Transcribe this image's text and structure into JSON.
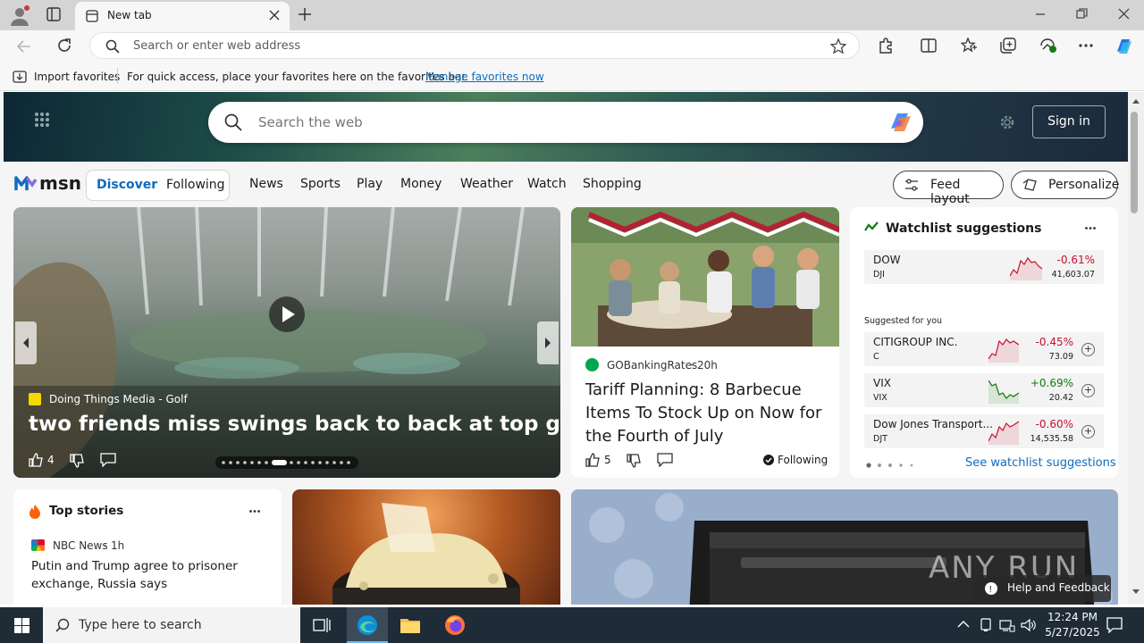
{
  "browser": {
    "tab_title": "New tab",
    "address_placeholder": "Search or enter web address",
    "favorites_bar": {
      "import_label": "Import favorites",
      "message": "For quick access, place your favorites here on the favorites bar.",
      "manage_link": "Manage favorites now"
    }
  },
  "msn": {
    "search_placeholder": "Search the web",
    "sign_in": "Sign in",
    "logo_text": "msn",
    "toggle": {
      "discover": "Discover",
      "following": "Following"
    },
    "nav": [
      "News",
      "Sports",
      "Play",
      "Money",
      "Weather",
      "Watch",
      "Shopping"
    ],
    "feed_layout": "Feed layout",
    "personalize": "Personalize",
    "hero_video": {
      "source": "Doing Things Media - Golf",
      "headline": "two friends miss swings back to back at top golf",
      "likes": "4"
    },
    "article": {
      "source": "GOBankingRates",
      "age": "20h",
      "headline": "Tariff Planning: 8 Barbecue Items To Stock Up on Now for the Fourth of July",
      "likes": "5",
      "following": "Following"
    },
    "watchlist": {
      "title": "Watchlist suggestions",
      "featured": {
        "name": "DOW",
        "symbol": "DJI",
        "change": "-0.61%",
        "value": "41,603.07"
      },
      "suggested_label": "Suggested for you",
      "items": [
        {
          "name": "CITIGROUP INC.",
          "symbol": "C",
          "change": "-0.45%",
          "value": "73.09",
          "up": false
        },
        {
          "name": "VIX",
          "symbol": "VIX",
          "change": "+0.69%",
          "value": "20.42",
          "up": true
        },
        {
          "name": "Dow Jones Transport...",
          "symbol": "DJT",
          "change": "-0.60%",
          "value": "14,535.58",
          "up": false
        }
      ],
      "see_more": "See watchlist suggestions"
    },
    "top_stories": {
      "title": "Top stories",
      "source": "NBC News",
      "age": "1h",
      "headline": "Putin and Trump agree to prisoner exchange, Russia says"
    },
    "help_feedback": "Help and Feedback",
    "watermark": "ANY RUN"
  },
  "colors": {
    "accent": "#0f6cbd",
    "negative": "#c8102e",
    "positive": "#0e7a0d",
    "taskbar": "#1f2b37"
  },
  "taskbar": {
    "search_placeholder": "Type here to search",
    "time": "12:24 PM",
    "date": "5/27/2025"
  }
}
